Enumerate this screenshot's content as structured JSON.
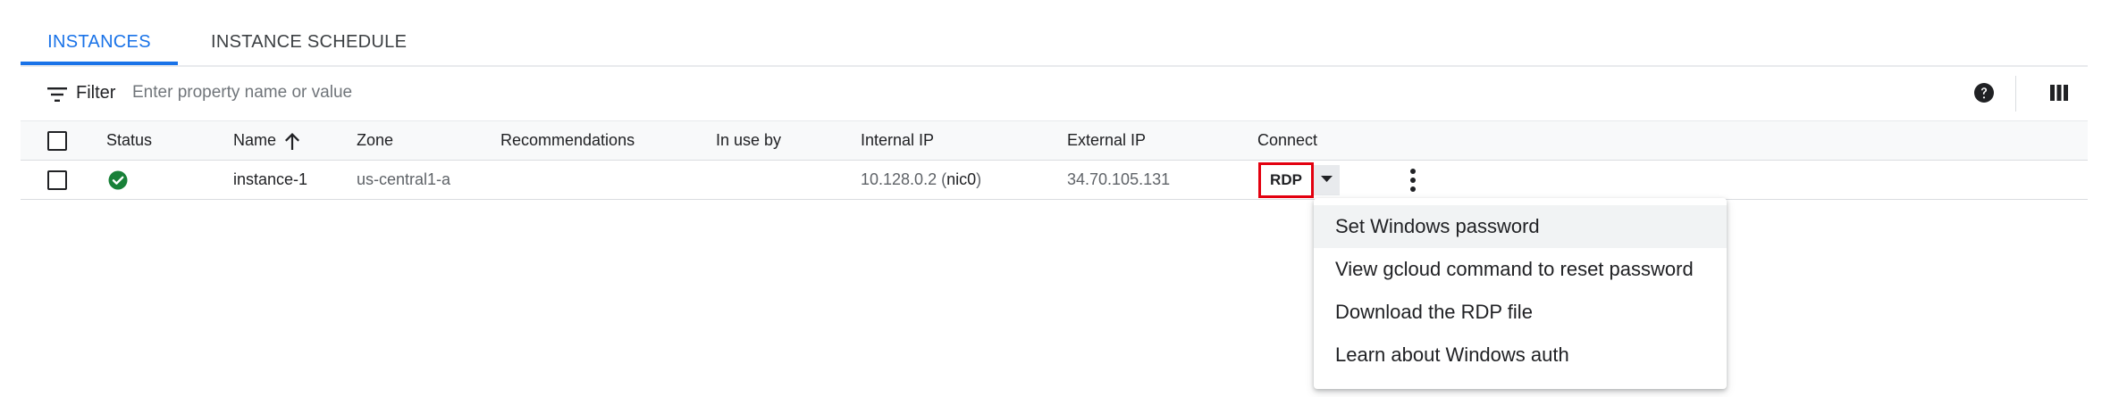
{
  "tabs": [
    {
      "label": "INSTANCES",
      "active": true
    },
    {
      "label": "INSTANCE SCHEDULE",
      "active": false
    }
  ],
  "filter": {
    "label": "Filter",
    "placeholder": "Enter property name or value",
    "value": ""
  },
  "toolbar": {
    "help_icon": "help-circle-icon",
    "columns_icon": "column-display-icon"
  },
  "table": {
    "columns": [
      "Status",
      "Name",
      "Zone",
      "Recommendations",
      "In use by",
      "Internal IP",
      "External IP",
      "Connect"
    ],
    "sort": {
      "column": "Name",
      "direction": "ascending"
    },
    "rows": [
      {
        "status": "running",
        "name": "instance-1",
        "zone": "us-central1-a",
        "recommendations": "",
        "in_use_by": "",
        "internal_ip": "10.128.0.2",
        "internal_ip_nic_open": " (",
        "internal_ip_nic": "nic0",
        "internal_ip_nic_close": ")",
        "external_ip": "34.70.105.131",
        "connect_label": "RDP"
      }
    ]
  },
  "connect_menu": {
    "items": [
      {
        "label": "Set Windows password"
      },
      {
        "label": "View gcloud command to reset password"
      },
      {
        "label": "Download the RDP file"
      },
      {
        "label": "Learn about Windows auth"
      }
    ]
  },
  "colors": {
    "accent": "#1a73e8",
    "status_ok": "#188038",
    "highlight_border": "#e3000f",
    "header_bg": "#f8f9fa"
  }
}
